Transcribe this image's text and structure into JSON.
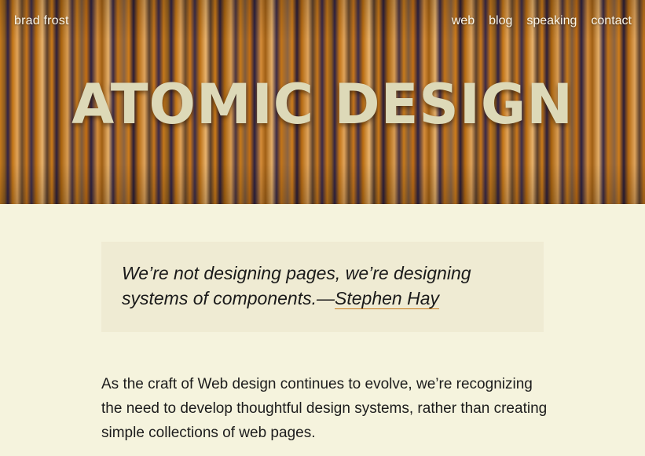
{
  "header": {
    "brand": "brad frost",
    "nav": [
      "web",
      "blog",
      "speaking",
      "contact"
    ],
    "title": "ATOMIC DESIGN"
  },
  "quote": {
    "text": "We’re not designing pages, we’re designing systems of components.—",
    "cite": "Stephen Hay"
  },
  "intro": {
    "paragraph": "As the craft of Web design continues to evolve, we’re recognizing the need to develop thoughtful design systems, rather than creating simple collections of web pages."
  },
  "colors": {
    "background": "#f5f3dd",
    "quote_background": "#efebd3",
    "accent": "#c77a1a",
    "title": "#ddd9b8"
  }
}
